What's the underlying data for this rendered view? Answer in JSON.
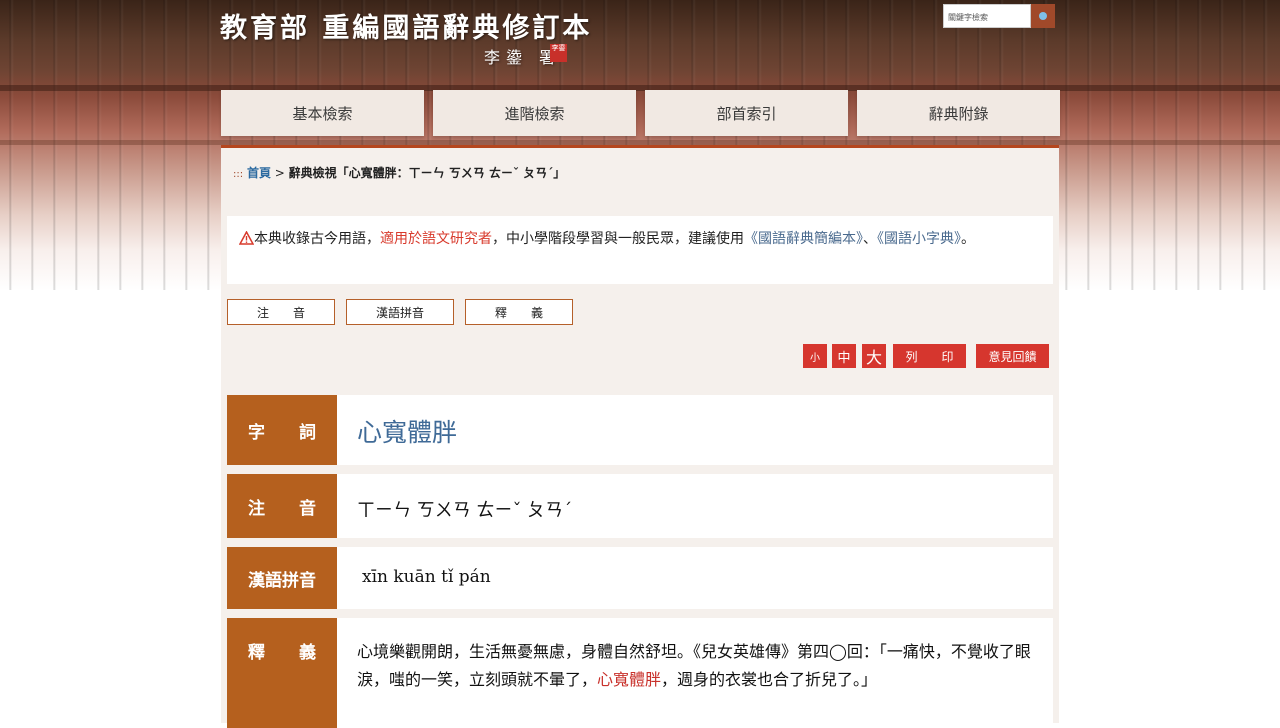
{
  "header": {
    "title": "教育部 重編國語辭典修訂本",
    "subtitle": "李鍌 署",
    "seal": "李鍌"
  },
  "search": {
    "placeholder": "關鍵字檢索"
  },
  "nav": [
    "基本檢索",
    "進階檢索",
    "部首索引",
    "辭典附錄"
  ],
  "breadcrumb": {
    "prefix": ":::",
    "home": "首頁",
    "separator": ">",
    "current": "辭典檢視「心寬體胖：ㄒㄧㄣ ㄎㄨㄢ ㄊㄧˇ ㄆㄢˊ」"
  },
  "notice": {
    "part1": "本典收錄古今用語，",
    "warn": "適用於語文研究者",
    "part2": "，中小學階段學習與一般民眾，建議使用",
    "link1": "《國語辭典簡編本》",
    "sep": "、",
    "link2": "《國語小字典》",
    "end": "。"
  },
  "tabs": [
    "注　　音",
    "漢語拼音",
    "釋　　義"
  ],
  "tools": {
    "small": "小",
    "medium": "中",
    "large": "大",
    "print": "列　　印",
    "feedback": "意見回饋"
  },
  "entry": {
    "word_label": "字　　詞",
    "word": "心寬體胖",
    "zhuyin_label": "注　　音",
    "zhuyin": "ㄒㄧㄣ ㄎㄨㄢ ㄊㄧˇ ㄆㄢˊ",
    "pinyin_label": "漢語拼音",
    "pinyin": "xīn kuān tǐ pán",
    "def_label": "釋　　義",
    "def_part1": "心境樂觀開朗，生活無憂無慮，身體自然舒坦。《兒女英雄傳》第四◯回：「一痛快，不覺收了眼淚，嗤的一笑，立刻頭就不暈了，",
    "def_highlight": "心寬體胖",
    "def_part2": "，週身的衣裳也合了折兒了。」"
  },
  "colors": {
    "accent": "#b5601e",
    "tool_red": "#d6362e",
    "link": "#4a6a8e",
    "word": "#3f6a97",
    "highlight": "#c8302a"
  },
  "icons": [
    "search-icon",
    "warning-icon"
  ]
}
